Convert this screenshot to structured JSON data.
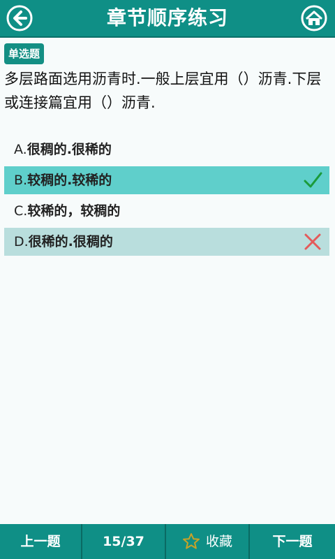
{
  "header": {
    "title": "章节顺序练习",
    "back_icon": "arrow-left-circle-icon",
    "home_icon": "home-circle-icon"
  },
  "question": {
    "type_badge": "单选题",
    "text": "多层路面选用沥青时.一般上层宜用（）沥青.下层或连接篇宜用（）沥青."
  },
  "options": [
    {
      "letter": "A.",
      "text": "很稠的.很稀的",
      "state": "plain"
    },
    {
      "letter": "B.",
      "text": "较稠的.较稀的",
      "state": "correct"
    },
    {
      "letter": "C.",
      "text": "较稀的，较稠的",
      "state": "plain"
    },
    {
      "letter": "D.",
      "text": "很稀的.很稠的",
      "state": "wrong"
    }
  ],
  "footer": {
    "prev_label": "上一题",
    "progress": "15/37",
    "favorite_label": "收藏",
    "favorite_icon": "star-outline-icon",
    "next_label": "下一题"
  },
  "colors": {
    "primary": "#0f8f86",
    "correct_bg": "#5fcfcb",
    "wrong_bg": "#b9dedd",
    "check": "#1a9b3a",
    "cross": "#e45a5a",
    "star": "#c9a227"
  }
}
